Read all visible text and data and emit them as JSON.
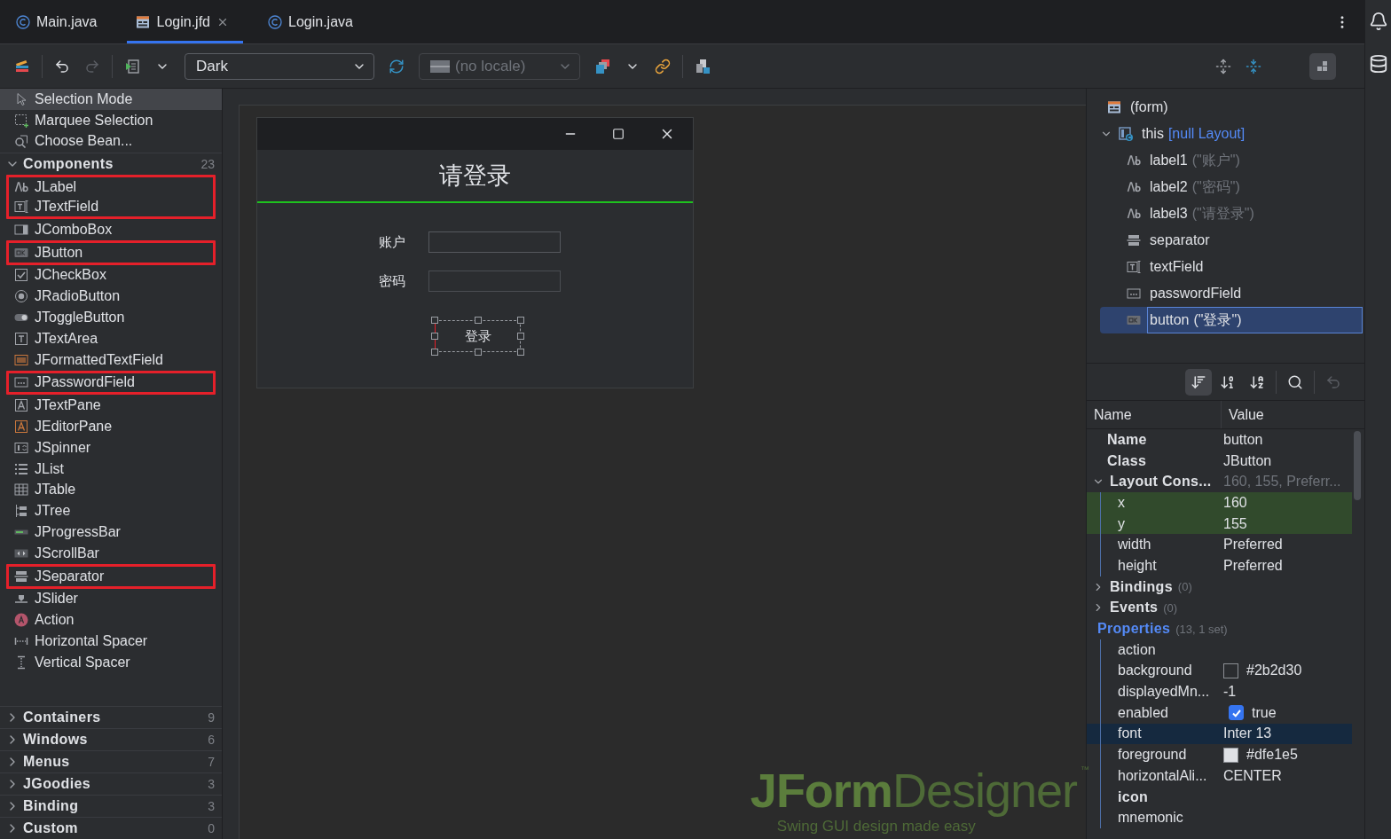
{
  "tabs": [
    {
      "label": "Main.java",
      "kind": "java",
      "selected": false,
      "closable": false
    },
    {
      "label": "Login.jfd",
      "kind": "form",
      "selected": true,
      "closable": true
    },
    {
      "label": "Login.java",
      "kind": "java",
      "selected": false,
      "closable": false
    }
  ],
  "toolbar": {
    "theme": {
      "value": "Dark"
    },
    "redo": {
      "disabled": true
    },
    "locale": {
      "value": "(no locale)",
      "disabled": true
    },
    "layout_toggle": {
      "selected": true
    }
  },
  "palette": {
    "tools": [
      {
        "kind": "pointer",
        "label": "Selection Mode",
        "selected": true
      },
      {
        "kind": "marquee",
        "label": "Marquee Selection",
        "selected": false
      },
      {
        "kind": "bean",
        "label": "Choose Bean...",
        "selected": false
      }
    ],
    "sections": [
      {
        "title": "Components",
        "count": "23",
        "expanded": true,
        "items": [
          {
            "kind": "label",
            "label": "JLabel",
            "marked": true
          },
          {
            "kind": "textfield",
            "label": "JTextField",
            "marked": true
          },
          {
            "kind": "combobox",
            "label": "JComboBox",
            "marked": false
          },
          {
            "kind": "button",
            "label": "JButton",
            "marked": true
          },
          {
            "kind": "checkbox",
            "label": "JCheckBox",
            "marked": false
          },
          {
            "kind": "radio",
            "label": "JRadioButton",
            "marked": false
          },
          {
            "kind": "toggle",
            "label": "JToggleButton",
            "marked": false
          },
          {
            "kind": "textarea",
            "label": "JTextArea",
            "marked": false
          },
          {
            "kind": "formatted",
            "label": "JFormattedTextField",
            "marked": false
          },
          {
            "kind": "password",
            "label": "JPasswordField",
            "marked": true
          },
          {
            "kind": "textpane",
            "label": "JTextPane",
            "marked": false
          },
          {
            "kind": "editorpane",
            "label": "JEditorPane",
            "marked": false
          },
          {
            "kind": "spinner",
            "label": "JSpinner",
            "marked": false
          },
          {
            "kind": "list",
            "label": "JList",
            "marked": false
          },
          {
            "kind": "table",
            "label": "JTable",
            "marked": false
          },
          {
            "kind": "tree",
            "label": "JTree",
            "marked": false
          },
          {
            "kind": "progress",
            "label": "JProgressBar",
            "marked": false
          },
          {
            "kind": "scrollbar",
            "label": "JScrollBar",
            "marked": false
          },
          {
            "kind": "separator",
            "label": "JSeparator",
            "marked": true
          },
          {
            "kind": "slider",
            "label": "JSlider",
            "marked": false
          },
          {
            "kind": "action",
            "label": "Action",
            "marked": false
          },
          {
            "kind": "hspacer",
            "label": "Horizontal Spacer",
            "marked": false
          },
          {
            "kind": "vspacer",
            "label": "Vertical Spacer",
            "marked": false
          }
        ]
      },
      {
        "title": "Containers",
        "count": "9",
        "expanded": false
      },
      {
        "title": "Windows",
        "count": "6",
        "expanded": false
      },
      {
        "title": "Menus",
        "count": "7",
        "expanded": false
      },
      {
        "title": "JGoodies",
        "count": "3",
        "expanded": false
      },
      {
        "title": "Binding",
        "count": "3",
        "expanded": false
      },
      {
        "title": "Custom",
        "count": "0",
        "expanded": false
      }
    ]
  },
  "form_preview": {
    "title": "请登录",
    "fields": [
      {
        "label": "账户",
        "kind": "text"
      },
      {
        "label": "密码",
        "kind": "password"
      }
    ],
    "button": {
      "label": "登录",
      "selected": true
    }
  },
  "logo": {
    "title": "**JForm**Designer",
    "trademark": "™",
    "tagline": "Swing GUI design made easy"
  },
  "tree": {
    "kind": "form",
    "name": "(form)",
    "selected": false,
    "children": [
      {
        "kind": "container",
        "name": "this",
        "hint": "[null Layout]",
        "expanded": true,
        "selected": false,
        "children": [
          {
            "kind": "label",
            "name": "label1",
            "hint": "(\"账户\")",
            "selected": false
          },
          {
            "kind": "label",
            "name": "label2",
            "hint": "(\"密码\")",
            "selected": false
          },
          {
            "kind": "label",
            "name": "label3",
            "hint": "(\"请登录\")",
            "selected": false
          },
          {
            "kind": "separator",
            "name": "separator",
            "selected": false
          },
          {
            "kind": "textfield",
            "name": "textField",
            "selected": false
          },
          {
            "kind": "password",
            "name": "passwordField",
            "selected": false
          },
          {
            "kind": "button",
            "name": "button",
            "hint": "(\"登录\")",
            "selected": true
          }
        ]
      }
    ]
  },
  "property_toolbar": {
    "buttons": [
      {
        "kind": "categorized",
        "selected": true
      },
      {
        "kind": "grouped",
        "selected": false
      },
      {
        "kind": "alpha",
        "selected": false
      },
      {
        "kind": "search",
        "selected": false
      }
    ],
    "revert": {
      "disabled": true
    }
  },
  "properties": {
    "columns": [
      "Name",
      "Value"
    ],
    "rows": [
      {
        "kind": "prop",
        "name": "Name",
        "value": "button"
      },
      {
        "kind": "prop",
        "name": "Class",
        "value": "JButton"
      },
      {
        "kind": "group",
        "name": "Layout Cons...",
        "summary": "160, 155, Preferr...",
        "expanded": true,
        "modified": false,
        "children": [
          {
            "kind": "text",
            "name": "x",
            "value": "160",
            "changed": true,
            "selected": false,
            "bold": false
          },
          {
            "kind": "text",
            "name": "y",
            "value": "155",
            "changed": true,
            "selected": false,
            "bold": false
          },
          {
            "kind": "text",
            "name": "width",
            "value": "Preferred",
            "changed": false,
            "selected": false,
            "bold": false
          },
          {
            "kind": "text",
            "name": "height",
            "value": "Preferred",
            "changed": false,
            "selected": false,
            "bold": false
          }
        ]
      },
      {
        "kind": "group",
        "name": "Bindings",
        "count": "(0)",
        "expanded": false,
        "modified": false
      },
      {
        "kind": "group",
        "name": "Events",
        "count": "(0)",
        "expanded": false,
        "modified": false
      },
      {
        "kind": "group",
        "name": "Properties",
        "count": "(13, 1 set)",
        "expanded": true,
        "modified": true,
        "children": [
          {
            "kind": "text",
            "name": "action",
            "changed": false,
            "selected": false,
            "bold": false
          },
          {
            "kind": "color",
            "name": "background",
            "value": "#2b2d30",
            "color": "#2b2d30",
            "changed": false,
            "selected": false,
            "bold": false
          },
          {
            "kind": "text",
            "name": "displayedMn...",
            "value": "-1",
            "changed": false,
            "selected": false,
            "bold": false
          },
          {
            "kind": "checkbox",
            "name": "enabled",
            "value": "true",
            "checked": true,
            "changed": false,
            "selected": false,
            "bold": false
          },
          {
            "kind": "text",
            "name": "font",
            "value": "Inter 13",
            "changed": false,
            "selected": true,
            "bold": false
          },
          {
            "kind": "color",
            "name": "foreground",
            "value": "#dfe1e5",
            "color": "#dfe1e5",
            "changed": false,
            "selected": false,
            "bold": false
          },
          {
            "kind": "text",
            "name": "horizontalAli...",
            "value": "CENTER",
            "changed": false,
            "selected": false,
            "bold": false
          },
          {
            "kind": "text",
            "name": "icon",
            "changed": false,
            "selected": false,
            "bold": true
          },
          {
            "kind": "text",
            "name": "mnemonic",
            "changed": false,
            "selected": false,
            "bold": false
          }
        ]
      }
    ]
  }
}
